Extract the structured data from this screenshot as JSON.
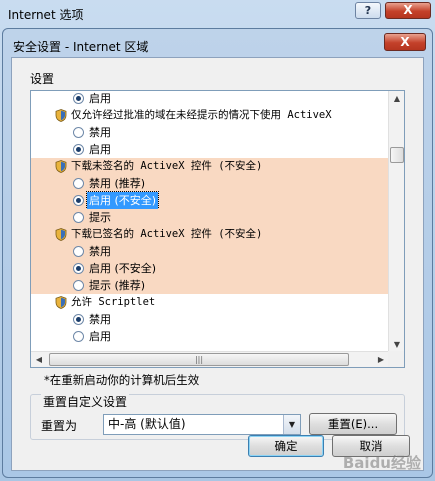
{
  "background_window": {
    "title": "Internet 选项",
    "help_label": "?",
    "close_label": "X"
  },
  "dialog": {
    "title": "安全设置 - Internet 区域",
    "close_label": "X",
    "settings_label": "设置",
    "rows": [
      {
        "type": "radio",
        "label": "启用",
        "checked": true,
        "highlight": false
      },
      {
        "type": "header",
        "label": "仅允许经过批准的域在未经提示的情况下使用 ActiveX",
        "highlight": false
      },
      {
        "type": "radio",
        "label": "禁用",
        "checked": false,
        "highlight": false
      },
      {
        "type": "radio",
        "label": "启用",
        "checked": true,
        "highlight": false
      },
      {
        "type": "header",
        "label": "下载未签名的 ActiveX 控件 (不安全)",
        "highlight": true
      },
      {
        "type": "radio",
        "label": "禁用 (推荐)",
        "checked": false,
        "highlight": true
      },
      {
        "type": "radio",
        "label": "启用 (不安全)",
        "checked": true,
        "highlight": true,
        "selected": true
      },
      {
        "type": "radio",
        "label": "提示",
        "checked": false,
        "highlight": true
      },
      {
        "type": "header",
        "label": "下载已签名的 ActiveX 控件 (不安全)",
        "highlight": true
      },
      {
        "type": "radio",
        "label": "禁用",
        "checked": false,
        "highlight": true
      },
      {
        "type": "radio",
        "label": "启用 (不安全)",
        "checked": true,
        "highlight": true
      },
      {
        "type": "radio",
        "label": "提示 (推荐)",
        "checked": false,
        "highlight": true
      },
      {
        "type": "header",
        "label": "允许 Scriptlet",
        "highlight": false
      },
      {
        "type": "radio",
        "label": "禁用",
        "checked": true,
        "highlight": false
      },
      {
        "type": "radio",
        "label": "启用",
        "checked": false,
        "highlight": false
      }
    ],
    "note": "*在重新启动你的计算机后生效",
    "reset_group": {
      "title": "重置自定义设置",
      "reset_to_label": "重置为",
      "selected_level": "中-高 (默认值)",
      "reset_button": "重置(E)..."
    },
    "ok_button": "确定",
    "cancel_button": "取消"
  },
  "watermark": "Baidu经验",
  "colors": {
    "highlight_row": "#f9d9c2",
    "selection": "#3399ff",
    "close_button": "#c4412a"
  }
}
